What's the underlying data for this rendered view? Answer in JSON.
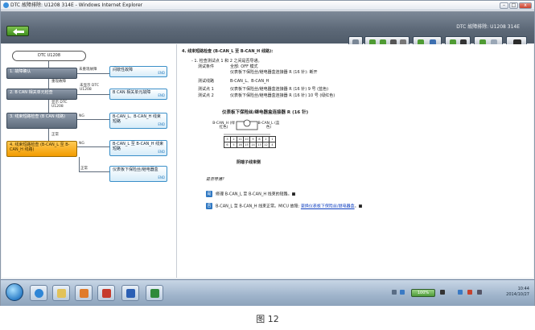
{
  "window": {
    "title": "DTC 故障排除: U1208 314E - Windows Internet Explorer",
    "min_glyph": "–",
    "max_glyph": "□",
    "close_glyph": "x"
  },
  "header": {
    "app_title": "DTC 故障排除: U1208 314E",
    "back_icon": "back-arrow-icon",
    "accent": "#4f9b34"
  },
  "flow": {
    "dtc": "DTC U1208",
    "steps": [
      {
        "label": "1. 故障确认"
      },
      {
        "label": "2. B CAN 相关单元检查"
      },
      {
        "label": "3. 线束短路检查 (B CAN 线路)"
      },
      {
        "label": "4. 线束短路检查 (B-CAN_L 至 B-CAN_H 线路)"
      }
    ],
    "branch_labels": {
      "not_detected": "未重现故障",
      "reproduced": "重现故障",
      "not_shown": "未显示 DTC U1208",
      "shown": "显示 DTC U1208",
      "ng3": "NG",
      "ok3": "正常",
      "ng4": "NG",
      "ok4": "正常"
    },
    "results": [
      {
        "label": "间歇性故障",
        "tag": "END"
      },
      {
        "label": "B CAN 相关单元故障",
        "tag": "END"
      },
      {
        "label": "B-CAN_L、B-CAN_H 线束短路",
        "tag": "END"
      },
      {
        "label": "B-CAN_L 至 B-CAN_H 线束短路",
        "tag": "END"
      },
      {
        "label": "仪表板下保险丝/继电器盒",
        "tag": "END"
      }
    ]
  },
  "detail": {
    "heading": "4. 线束短路检查 (B-CAN_L 至 B-CAN_H 线路):",
    "lines": [
      "- 1. 检查测试点 1 和 2 之间是否导通。",
      "测试条件",
      "全部: OFF 模式",
      "仪表板下保险丝/继电器盒连接器 R (16 针): 断开",
      "测试线路",
      "B-CAN_L、B-CAN_H",
      "测试点 1",
      "仪表板下保险丝/继电器盒连接器 R (16 针) 9 号 (蓝色)",
      "测试点 2",
      "仪表板下保险丝/继电器盒连接器 R (16 针) 10 号 (绿红色)"
    ],
    "connector_title": "仪表板下保险丝/继电器盒连接器 R (16 针)",
    "label_left": "B-CAN_H (绿红色)",
    "label_right": "B-CAN_L (蓝色)",
    "pin_row1": [
      "3",
      "2",
      "11",
      "10",
      "9",
      "8",
      "2",
      "1"
    ],
    "pin_row2": [
      "6",
      "5",
      "16",
      "15",
      "14",
      "13",
      "12",
      "4"
    ],
    "connector_caption": "阴端子线束侧",
    "question": "是否导通?",
    "option1_num": "是",
    "option1": "修理 B-CAN_L 至 B-CAN_H 线束的短路。■",
    "option2_num": "否",
    "option2_pre": "B-CAN_L 至 B-CAN_H 线束正常。MICU 故障: ",
    "option2_link": "更换仪表板下保险丝/继电器盒",
    "option2_post": "。■"
  },
  "taskbar": {
    "zoom": "100%",
    "time": "10:44",
    "date": "2014/10/27"
  },
  "caption": "图 12"
}
